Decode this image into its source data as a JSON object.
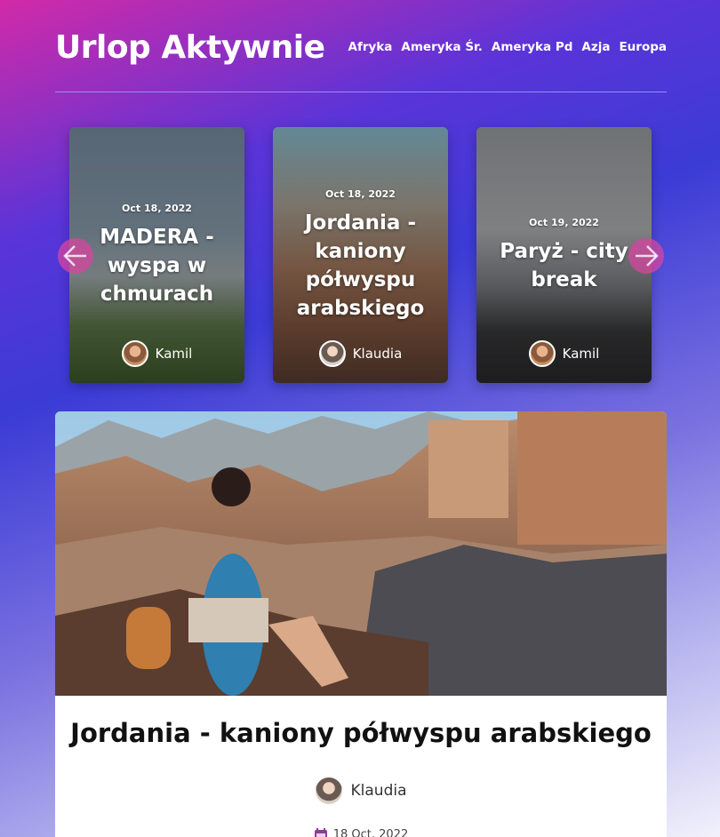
{
  "site": {
    "title": "Urlop Aktywnie"
  },
  "nav": [
    "Afryka",
    "Ameryka Śr.",
    "Ameryka Pd",
    "Azja",
    "Europa"
  ],
  "carousel": {
    "cards": [
      {
        "date": "Oct 18, 2022",
        "title": "MADERA - wyspa w chmurach",
        "author": "Kamil"
      },
      {
        "date": "Oct 18, 2022",
        "title": "Jordania - kaniony półwyspu arabskiego",
        "author": "Klaudia"
      },
      {
        "date": "Oct 19, 2022",
        "title": "Paryż - city break",
        "author": "Kamil"
      }
    ],
    "prev_icon": "arrow-left-icon",
    "next_icon": "arrow-right-icon"
  },
  "featured": {
    "title": "Jordania - kaniony półwyspu arabskiego",
    "author": "Klaudia",
    "date": "18 Oct, 2022",
    "date_icon": "calendar-icon"
  },
  "colors": {
    "accent": "#d646a0",
    "date_icon": "#8b3f93"
  }
}
